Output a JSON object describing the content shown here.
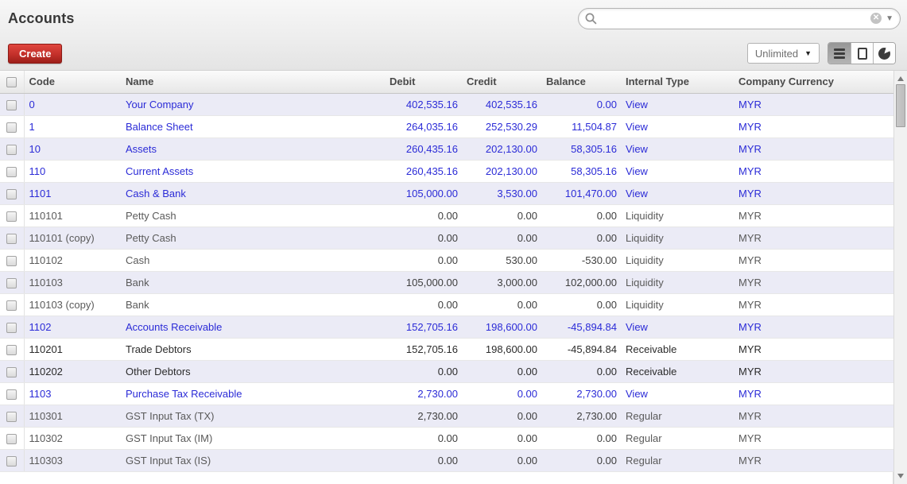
{
  "header": {
    "title": "Accounts"
  },
  "search": {
    "value": "",
    "placeholder": "",
    "icons": [
      "magnifier",
      "clear-circle-x",
      "caret-down"
    ]
  },
  "toolbar": {
    "create_label": "Create",
    "limit_selector": "Unlimited",
    "views": [
      "list",
      "form",
      "graph"
    ],
    "active_view": "list"
  },
  "table": {
    "columns": [
      "Code",
      "Name",
      "Debit",
      "Credit",
      "Balance",
      "Internal Type",
      "Company Currency"
    ],
    "rows": [
      {
        "code": "0",
        "name": "Your Company",
        "debit": "402,535.16",
        "credit": "402,535.16",
        "balance": "0.00",
        "internal_type": "View",
        "currency": "MYR"
      },
      {
        "code": "1",
        "name": "Balance Sheet",
        "debit": "264,035.16",
        "credit": "252,530.29",
        "balance": "11,504.87",
        "internal_type": "View",
        "currency": "MYR"
      },
      {
        "code": "10",
        "name": "Assets",
        "debit": "260,435.16",
        "credit": "202,130.00",
        "balance": "58,305.16",
        "internal_type": "View",
        "currency": "MYR"
      },
      {
        "code": "110",
        "name": "Current Assets",
        "debit": "260,435.16",
        "credit": "202,130.00",
        "balance": "58,305.16",
        "internal_type": "View",
        "currency": "MYR"
      },
      {
        "code": "1101",
        "name": "Cash & Bank",
        "debit": "105,000.00",
        "credit": "3,530.00",
        "balance": "101,470.00",
        "internal_type": "View",
        "currency": "MYR"
      },
      {
        "code": "110101",
        "name": "Petty Cash",
        "debit": "0.00",
        "credit": "0.00",
        "balance": "0.00",
        "internal_type": "Liquidity",
        "currency": "MYR"
      },
      {
        "code": "110101 (copy)",
        "name": "Petty Cash",
        "debit": "0.00",
        "credit": "0.00",
        "balance": "0.00",
        "internal_type": "Liquidity",
        "currency": "MYR"
      },
      {
        "code": "110102",
        "name": "Cash",
        "debit": "0.00",
        "credit": "530.00",
        "balance": "-530.00",
        "internal_type": "Liquidity",
        "currency": "MYR"
      },
      {
        "code": "110103",
        "name": "Bank",
        "debit": "105,000.00",
        "credit": "3,000.00",
        "balance": "102,000.00",
        "internal_type": "Liquidity",
        "currency": "MYR"
      },
      {
        "code": "110103 (copy)",
        "name": "Bank",
        "debit": "0.00",
        "credit": "0.00",
        "balance": "0.00",
        "internal_type": "Liquidity",
        "currency": "MYR"
      },
      {
        "code": "1102",
        "name": "Accounts Receivable",
        "debit": "152,705.16",
        "credit": "198,600.00",
        "balance": "-45,894.84",
        "internal_type": "View",
        "currency": "MYR"
      },
      {
        "code": "110201",
        "name": "Trade Debtors",
        "debit": "152,705.16",
        "credit": "198,600.00",
        "balance": "-45,894.84",
        "internal_type": "Receivable",
        "currency": "MYR"
      },
      {
        "code": "110202",
        "name": "Other Debtors",
        "debit": "0.00",
        "credit": "0.00",
        "balance": "0.00",
        "internal_type": "Receivable",
        "currency": "MYR"
      },
      {
        "code": "1103",
        "name": "Purchase Tax Receivable",
        "debit": "2,730.00",
        "credit": "0.00",
        "balance": "2,730.00",
        "internal_type": "View",
        "currency": "MYR"
      },
      {
        "code": "110301",
        "name": "GST Input Tax (TX)",
        "debit": "2,730.00",
        "credit": "0.00",
        "balance": "2,730.00",
        "internal_type": "Regular",
        "currency": "MYR"
      },
      {
        "code": "110302",
        "name": "GST Input Tax (IM)",
        "debit": "0.00",
        "credit": "0.00",
        "balance": "0.00",
        "internal_type": "Regular",
        "currency": "MYR"
      },
      {
        "code": "110303",
        "name": "GST Input Tax (IS)",
        "debit": "0.00",
        "credit": "0.00",
        "balance": "0.00",
        "internal_type": "Regular",
        "currency": "MYR"
      }
    ]
  },
  "colors": {
    "link_blue": "#2b2bd7",
    "create_button_red": "#c3302a",
    "row_stripe_lavender": "#ebebf6",
    "active_view_button_gray": "#a5a5a5"
  }
}
